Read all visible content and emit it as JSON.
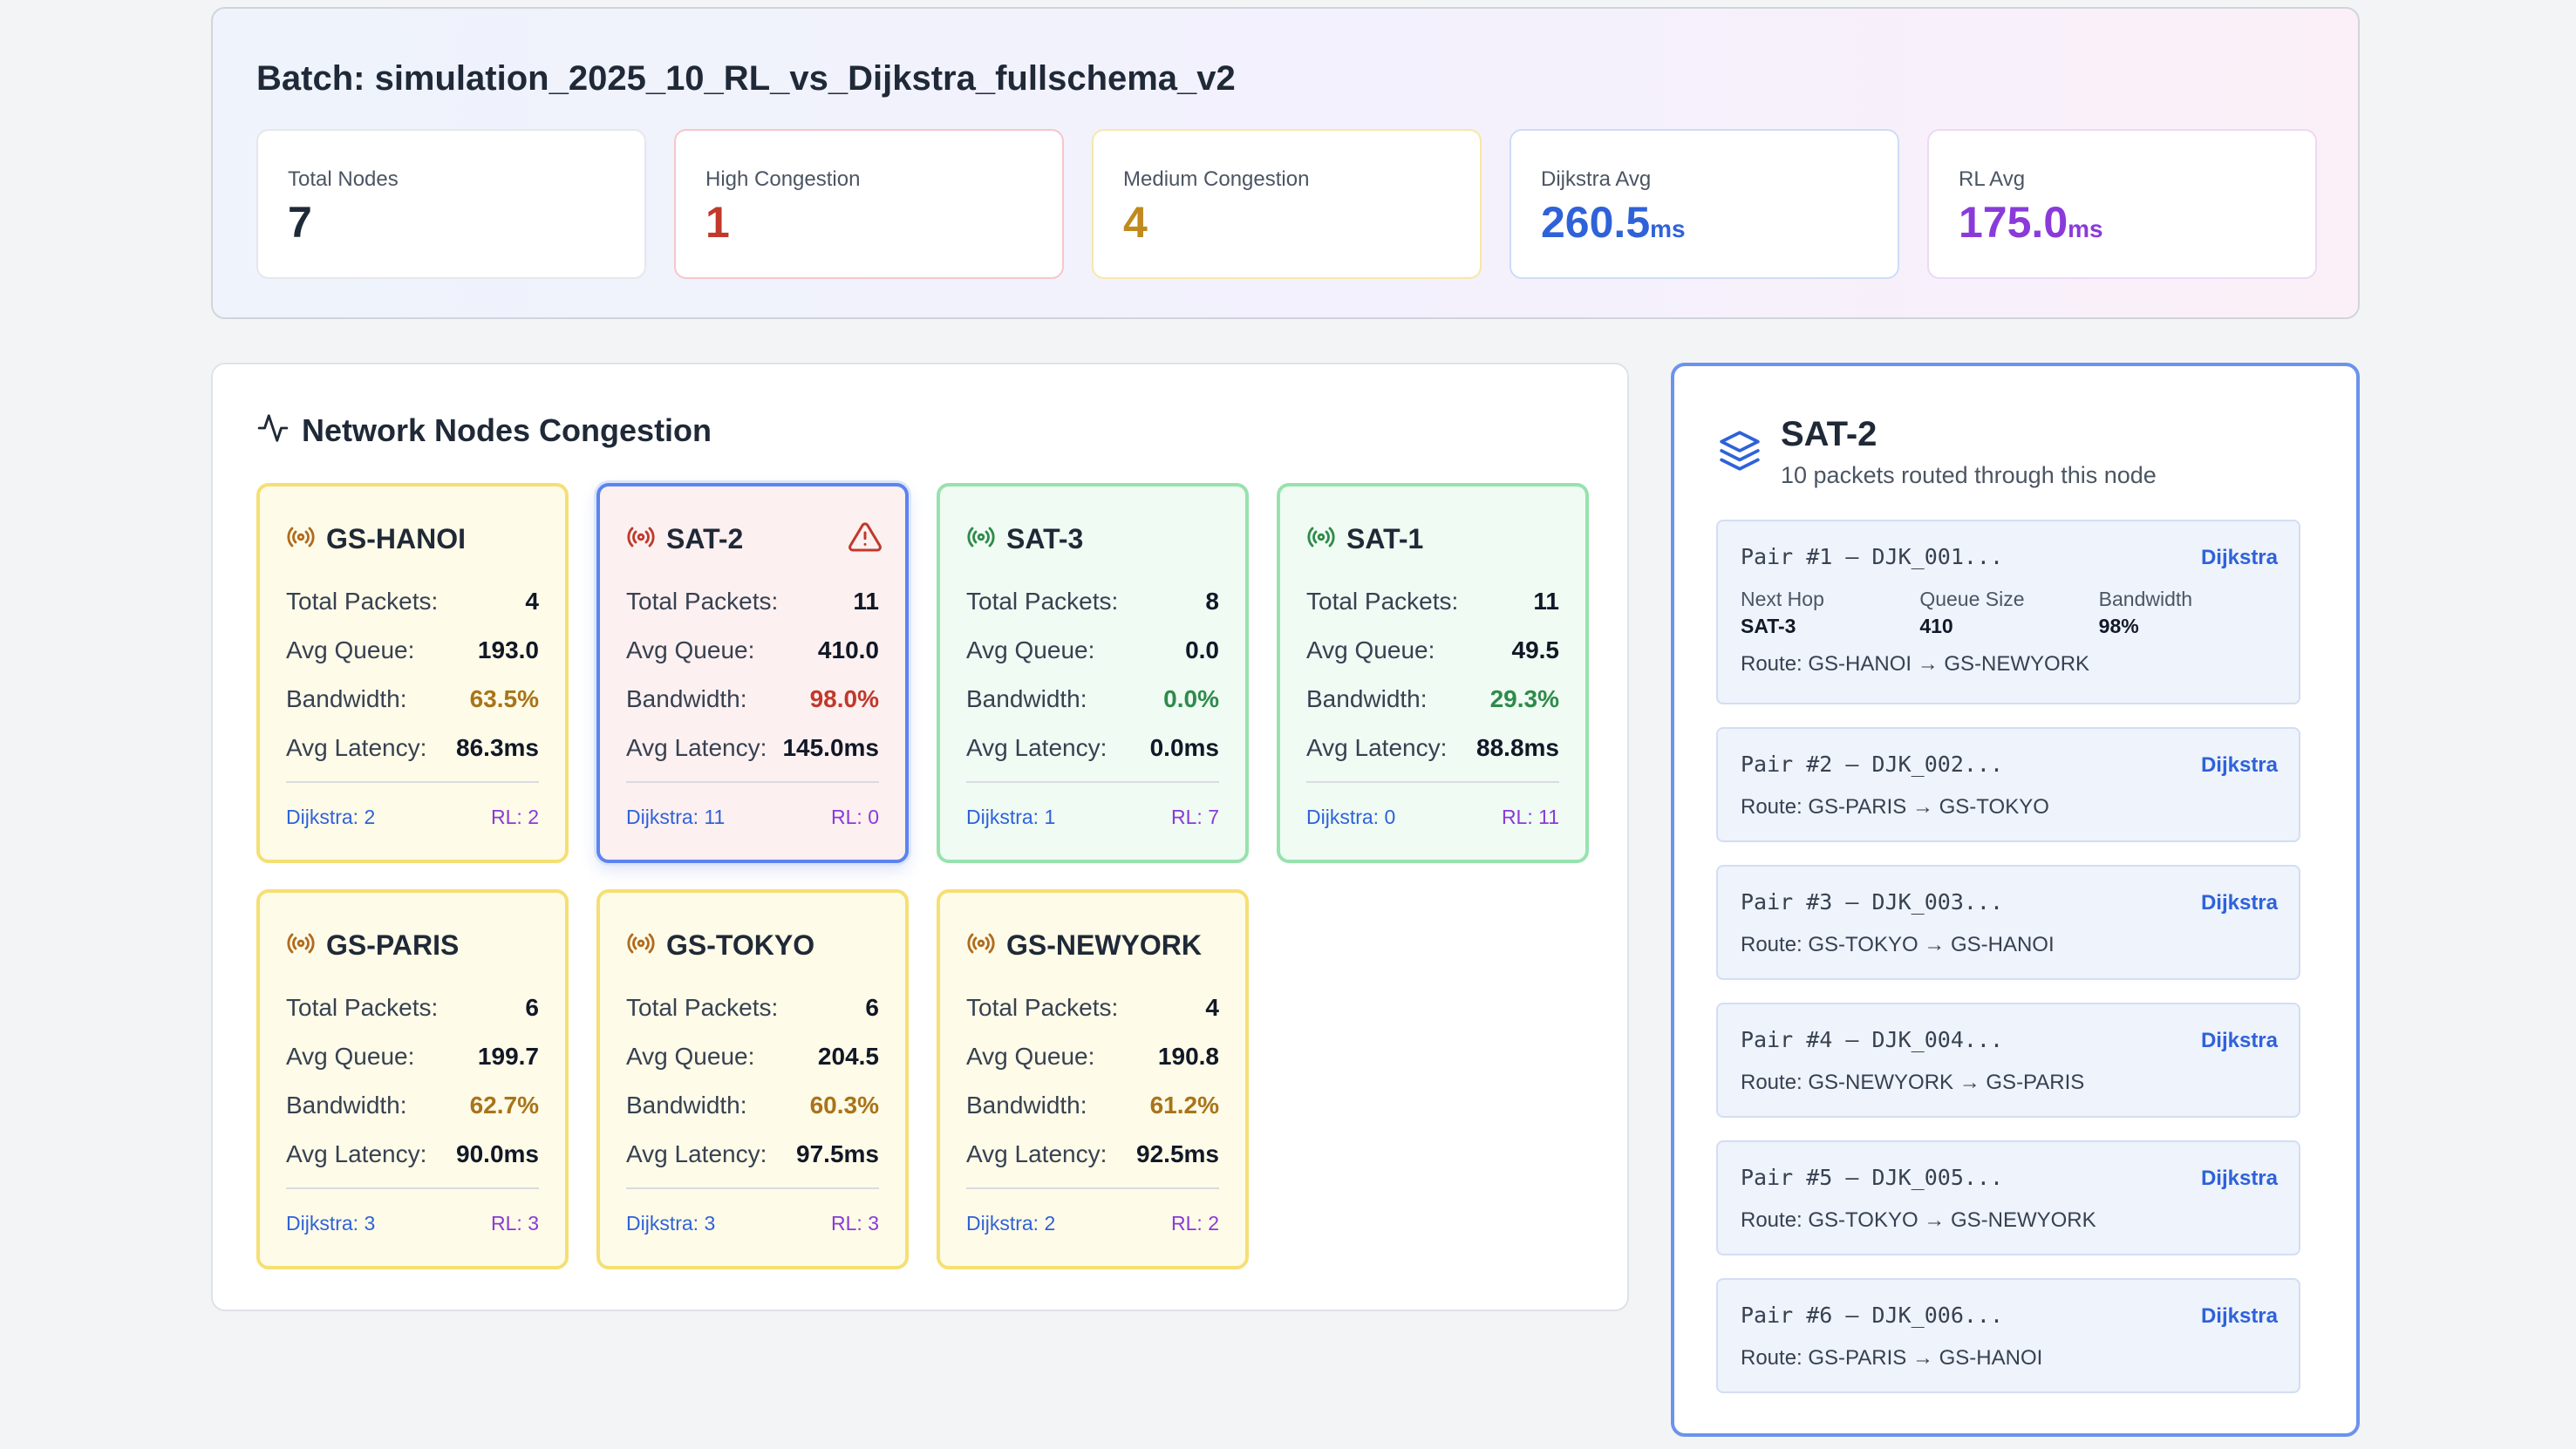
{
  "batch": {
    "title": "Batch: simulation_2025_10_RL_vs_Dijkstra_fullschema_v2"
  },
  "stats": [
    {
      "label": "Total Nodes",
      "value": "7",
      "unit": "",
      "color": "#1f2937"
    },
    {
      "label": "High Congestion",
      "value": "1",
      "unit": "",
      "color": "#c0392b"
    },
    {
      "label": "Medium Congestion",
      "value": "4",
      "unit": "",
      "color": "#c08a1e"
    },
    {
      "label": "Dijkstra Avg",
      "value": "260.5",
      "unit": "ms",
      "color": "#2f62d9"
    },
    {
      "label": "RL Avg",
      "value": "175.0",
      "unit": "ms",
      "color": "#8a3ad9"
    }
  ],
  "network": {
    "title": "Network Nodes Congestion",
    "labels": {
      "total_packets": "Total Packets:",
      "avg_queue": "Avg Queue:",
      "bandwidth": "Bandwidth:",
      "avg_latency": "Avg Latency:"
    },
    "nodes": [
      {
        "name": "GS-HANOI",
        "level": "medium",
        "total_packets": "4",
        "avg_queue": "193.0",
        "bandwidth": "63.5%",
        "avg_latency": "86.3ms",
        "dijkstra": "Dijkstra: 2",
        "rl": "RL: 2"
      },
      {
        "name": "SAT-2",
        "level": "high",
        "selected": true,
        "total_packets": "11",
        "avg_queue": "410.0",
        "bandwidth": "98.0%",
        "avg_latency": "145.0ms",
        "dijkstra": "Dijkstra: 11",
        "rl": "RL: 0"
      },
      {
        "name": "SAT-3",
        "level": "low",
        "total_packets": "8",
        "avg_queue": "0.0",
        "bandwidth": "0.0%",
        "avg_latency": "0.0ms",
        "dijkstra": "Dijkstra: 1",
        "rl": "RL: 7"
      },
      {
        "name": "SAT-1",
        "level": "low",
        "total_packets": "11",
        "avg_queue": "49.5",
        "bandwidth": "29.3%",
        "avg_latency": "88.8ms",
        "dijkstra": "Dijkstra: 0",
        "rl": "RL: 11"
      },
      {
        "name": "GS-PARIS",
        "level": "medium",
        "total_packets": "6",
        "avg_queue": "199.7",
        "bandwidth": "62.7%",
        "avg_latency": "90.0ms",
        "dijkstra": "Dijkstra: 3",
        "rl": "RL: 3"
      },
      {
        "name": "GS-TOKYO",
        "level": "medium",
        "total_packets": "6",
        "avg_queue": "204.5",
        "bandwidth": "60.3%",
        "avg_latency": "97.5ms",
        "dijkstra": "Dijkstra: 3",
        "rl": "RL: 3"
      },
      {
        "name": "GS-NEWYORK",
        "level": "medium",
        "total_packets": "4",
        "avg_queue": "190.8",
        "bandwidth": "61.2%",
        "avg_latency": "92.5ms",
        "dijkstra": "Dijkstra: 2",
        "rl": "RL: 2"
      }
    ]
  },
  "details": {
    "node": "SAT-2",
    "subtitle": "10 packets routed through this node",
    "metric_labels": {
      "next_hop": "Next Hop",
      "queue_size": "Queue Size",
      "bandwidth": "Bandwidth"
    },
    "pairs": [
      {
        "title": "Pair #1 – DJK_001...",
        "method": "Dijkstra",
        "route": "Route: GS-HANOI → GS-NEWYORK",
        "expanded": true,
        "next_hop": "SAT-3",
        "queue_size": "410",
        "bandwidth": "98%"
      },
      {
        "title": "Pair #2 – DJK_002...",
        "method": "Dijkstra",
        "route": "Route: GS-PARIS → GS-TOKYO"
      },
      {
        "title": "Pair #3 – DJK_003...",
        "method": "Dijkstra",
        "route": "Route: GS-TOKYO → GS-HANOI"
      },
      {
        "title": "Pair #4 – DJK_004...",
        "method": "Dijkstra",
        "route": "Route: GS-NEWYORK → GS-PARIS"
      },
      {
        "title": "Pair #5 – DJK_005...",
        "method": "Dijkstra",
        "route": "Route: GS-TOKYO → GS-NEWYORK"
      },
      {
        "title": "Pair #6 – DJK_006...",
        "method": "Dijkstra",
        "route": "Route: GS-PARIS → GS-HANOI"
      }
    ]
  },
  "colors": {
    "medium": "#b06b1e",
    "high": "#c0392b",
    "low": "#2e8b4a",
    "accent": "#2f62d9",
    "rl": "#8a3ad9"
  },
  "icons": [
    "activity-icon",
    "signal-icon",
    "warning-icon",
    "layers-icon"
  ]
}
